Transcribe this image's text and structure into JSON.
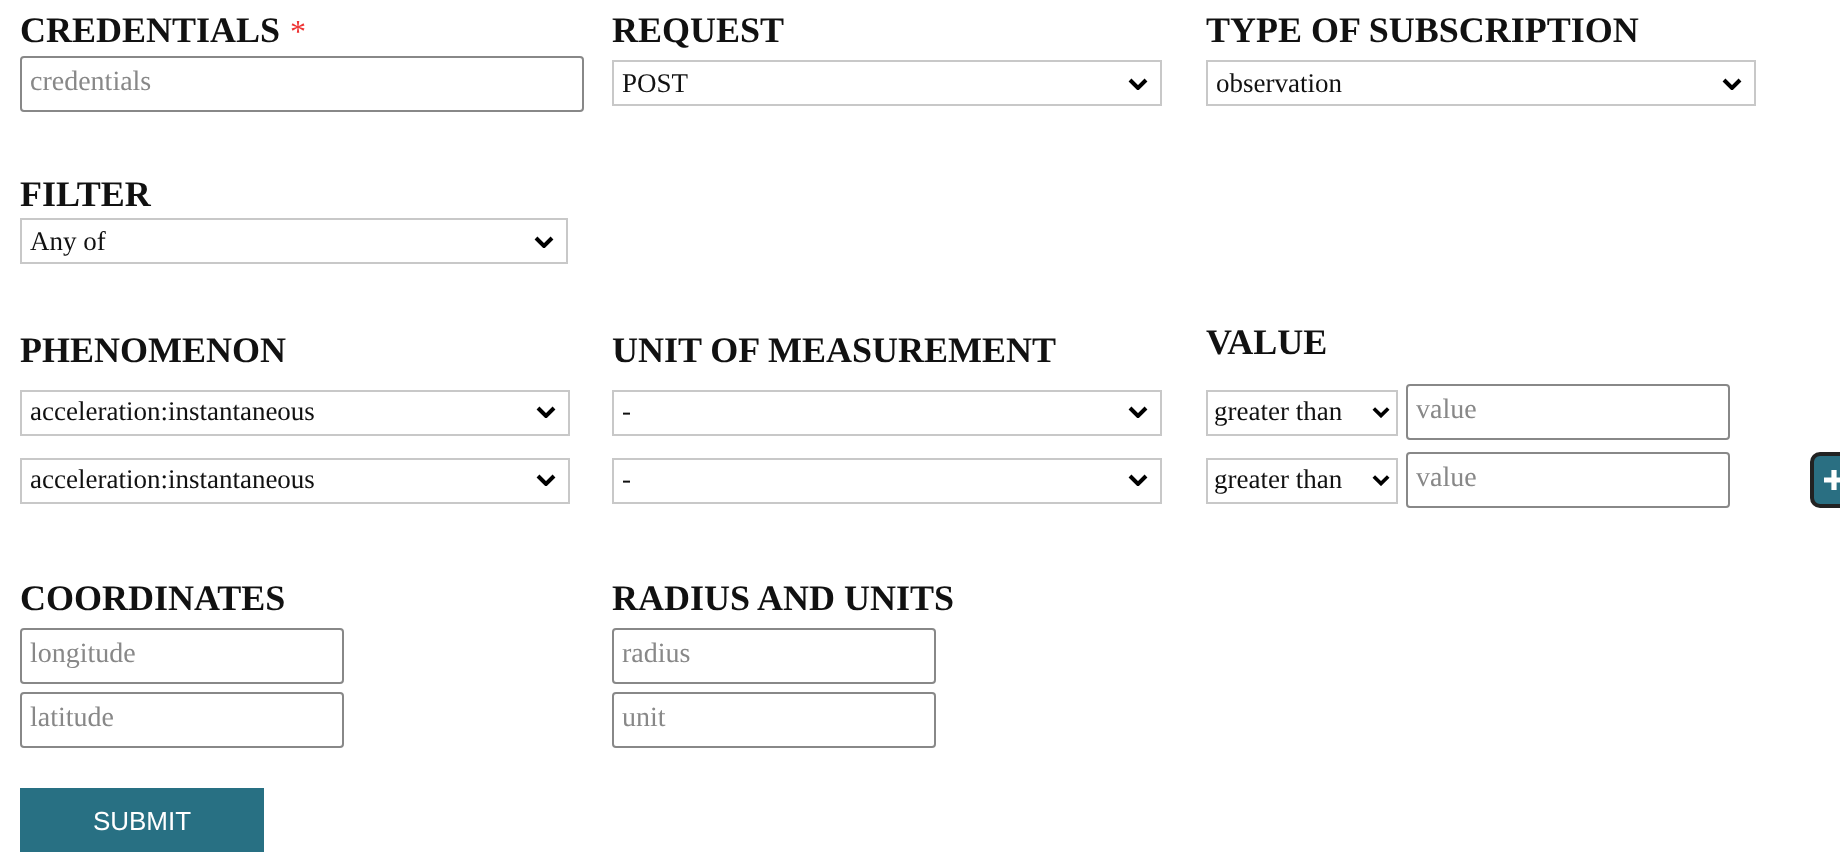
{
  "credentials": {
    "label": "CREDENTIALS",
    "required_mark": "*",
    "placeholder": "credentials"
  },
  "request": {
    "label": "REQUEST",
    "value": "POST"
  },
  "subscription_type": {
    "label": "TYPE OF SUBSCRIPTION",
    "value": "observation"
  },
  "filter": {
    "label": "FILTER",
    "value": "Any of"
  },
  "conditions": {
    "headers": [
      "PHENOMENON",
      "UNIT OF MEASUREMENT",
      "VALUE"
    ],
    "rows": [
      {
        "phenomenon": "acceleration:instantaneous",
        "unit": "-",
        "operator": "greater than",
        "placeholder": "value"
      },
      {
        "phenomenon": "acceleration:instantaneous",
        "unit": "-",
        "operator": "greater than",
        "placeholder": "value"
      }
    ]
  },
  "coordinates": {
    "label": "COORDINATES",
    "fields": [
      {
        "placeholder": "longitude"
      },
      {
        "placeholder": "latitude"
      }
    ]
  },
  "radius": {
    "label": "RADIUS AND UNITS",
    "fields": [
      {
        "placeholder": "radius"
      },
      {
        "placeholder": "unit"
      }
    ]
  },
  "submit": "SUBMIT"
}
